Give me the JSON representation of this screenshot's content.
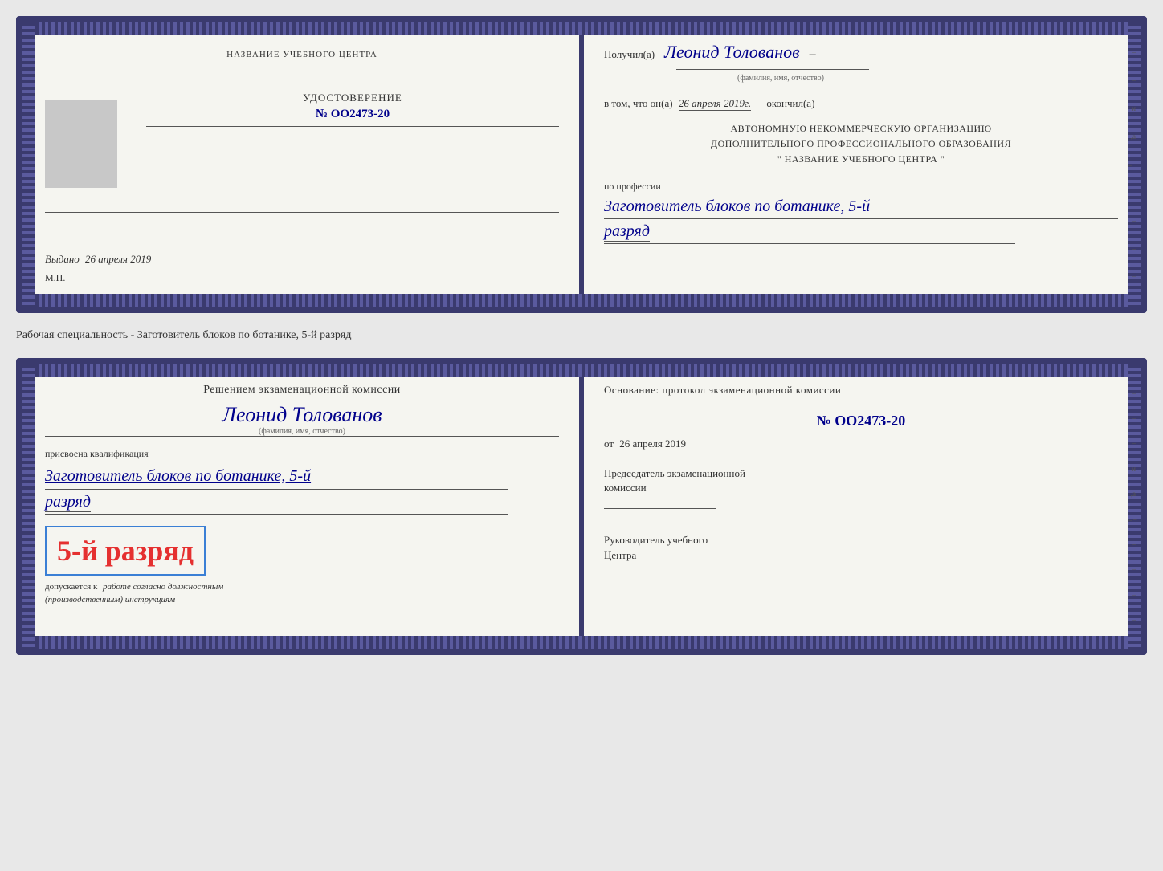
{
  "top_cert": {
    "left": {
      "title": "НАЗВАНИЕ УЧЕБНОГО ЦЕНТРА",
      "udost_label": "УДОСТОВЕРЕНИЕ",
      "number": "№ OO2473-20",
      "vydano_label": "Выдано",
      "vydano_date": "26 апреля 2019",
      "mp_label": "М.П."
    },
    "right": {
      "poluchil": "Получил(а)",
      "name": "Леонид Толованов",
      "fio_label": "(фамилия, имя, отчество)",
      "vtom": "в том, что он(а)",
      "date": "26 апреля 2019г.",
      "okончил": "окончил(а)",
      "avt_line1": "АВТОНОМНУЮ НЕКОММЕРЧЕСКУЮ ОРГАНИЗАЦИЮ",
      "avt_line2": "ДОПОЛНИТЕЛЬНОГО ПРОФЕССИОНАЛЬНОГО ОБРАЗОВАНИЯ",
      "avt_line3": "\"  НАЗВАНИЕ УЧЕБНОГО ЦЕНТРА  \"",
      "po_professii": "по профессии",
      "professiya": "Заготовитель блоков по ботанике, 5-й",
      "razryad": "разряд"
    }
  },
  "specialty_label": "Рабочая специальность - Заготовитель блоков по ботанике, 5-й разряд",
  "bottom_cert": {
    "left": {
      "resheniem": "Решением экзаменационной комиссии",
      "name": "Леонид Толованов",
      "fio_label": "(фамилия, имя, отчество)",
      "prisvoena": "присвоена квалификация",
      "kvali": "Заготовитель блоков по ботанике, 5-й",
      "razryad": "разряд",
      "grade": "5-й разряд",
      "dopusk1": "допускается к",
      "dopusk2": "работе согласно должностным",
      "dopusk3": "(производственным) инструкциям"
    },
    "right": {
      "osnovanie": "Основание: протокол экзаменационной комиссии",
      "number": "№  OO2473-20",
      "ot_label": "от",
      "ot_date": "26 апреля 2019",
      "predsedatel1": "Председатель экзаменационной",
      "predsedatel2": "комиссии",
      "rukovoditel1": "Руководитель учебного",
      "rukovoditel2": "Центра"
    }
  }
}
